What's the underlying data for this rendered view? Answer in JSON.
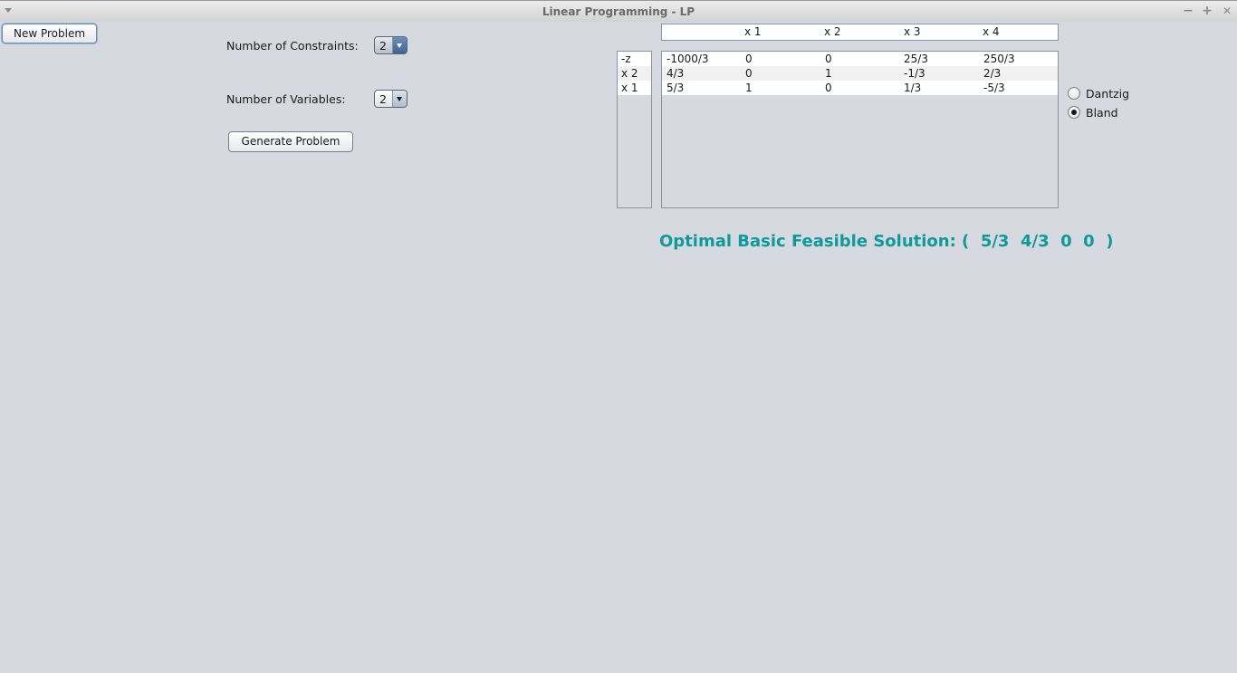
{
  "window": {
    "title": "Linear Programming - LP",
    "minimize_icon": "−",
    "maximize_icon": "+",
    "close_icon": "✕"
  },
  "toolbar": {
    "new_problem_label": "New Problem"
  },
  "setup": {
    "constraints_label": "Number of Constraints:",
    "constraints_value": "2",
    "variables_label": "Number of Variables:",
    "variables_value": "2",
    "generate_label": "Generate Problem"
  },
  "tableau": {
    "columns": [
      "",
      "x 1",
      "x 2",
      "x 3",
      "x 4"
    ],
    "row_labels": [
      "-z",
      "x 2",
      "x 1"
    ],
    "rows": [
      [
        "-1000/3",
        "0",
        "0",
        "25/3",
        "250/3"
      ],
      [
        "4/3",
        "0",
        "1",
        "-1/3",
        "2/3"
      ],
      [
        "5/3",
        "1",
        "0",
        "1/3",
        "-5/3"
      ]
    ]
  },
  "pivot_rule": {
    "options": [
      {
        "label": "Dantzig",
        "checked": false
      },
      {
        "label": "Bland",
        "checked": true
      }
    ]
  },
  "solution": {
    "text": "Optimal Basic Feasible Solution: (  5/3  4/3  0  0  )",
    "color": "#0e9a9a"
  },
  "colors": {
    "background": "#d6d9e0",
    "accent": "#0e9a9a"
  }
}
